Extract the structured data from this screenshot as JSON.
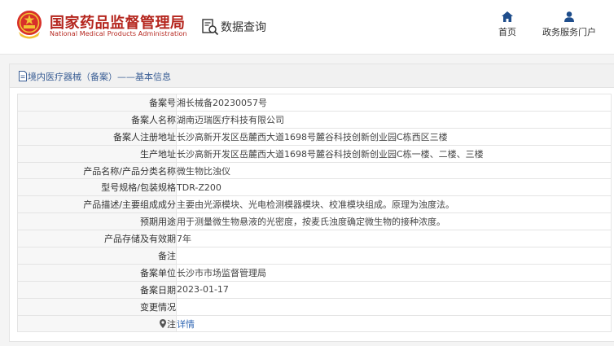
{
  "header": {
    "title_cn": "国家药品监督管理局",
    "title_en": "National Medical Products Administration",
    "data_query": "数据查询",
    "nav": [
      {
        "label": "首页",
        "icon": "home-icon"
      },
      {
        "label": "政务服务门户",
        "icon": "user-icon"
      }
    ]
  },
  "panel": {
    "title": "境内医疗器械（备案）——基本信息"
  },
  "rows": [
    {
      "label": "备案号",
      "value": "湘长械备20230057号"
    },
    {
      "label": "备案人名称",
      "value": "湖南迈瑞医疗科技有限公司"
    },
    {
      "label": "备案人注册地址",
      "value": "长沙高新开发区岳麓西大道1698号麓谷科技创新创业园C栋西区三楼"
    },
    {
      "label": "生产地址",
      "value": "长沙高新开发区岳麓西大道1698号麓谷科技创新创业园C栋一楼、二楼、三楼"
    },
    {
      "label": "产品名称/产品分类名称",
      "value": "微生物比浊仪"
    },
    {
      "label": "型号规格/包装规格",
      "value": "TDR-Z200"
    },
    {
      "label": "产品描述/主要组成成分",
      "value": "主要由光源模块、光电检测模器模块、校准模块组成。原理为浊度法。"
    },
    {
      "label": "预期用途",
      "value": "用于测量微生物悬液的光密度，按麦氏浊度确定微生物的接种浓度。"
    },
    {
      "label": "产品存储及有效期",
      "value": "7年"
    },
    {
      "label": "备注",
      "value": ""
    },
    {
      "label": "备案单位",
      "value": "长沙市市场监督管理局"
    },
    {
      "label": "备案日期",
      "value": "2023-01-17"
    },
    {
      "label": "变更情况",
      "value": ""
    }
  ],
  "note": {
    "label": "注",
    "link": "详情",
    "icon": "location-pin-icon"
  },
  "colors": {
    "brand_red": "#b5261e",
    "link_blue": "#2f66b3",
    "nav_blue": "#1f4e8c"
  }
}
